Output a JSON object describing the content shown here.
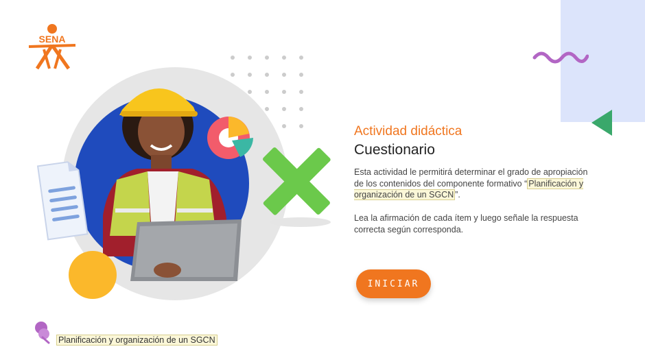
{
  "brand": {
    "logo_text": "SENA",
    "accent_color": "#f0761f"
  },
  "intro": {
    "subtitle": "Actividad didáctica",
    "title": "Cuestionario",
    "paragraph1_prefix": "Esta actividad le permitirá determinar el grado de apropiación de los contenidos del componente formativo “",
    "paragraph1_highlight": "Planificación y organización de un SGCN",
    "paragraph1_suffix": "”.",
    "paragraph2": "Lea la afirmación de cada ítem y luego señale la respuesta correcta según corresponda."
  },
  "actions": {
    "start_label": "INICIAR"
  },
  "footer": {
    "course_name": "Planificación y organización de un SGCN"
  },
  "icons": [
    "sena-logo",
    "document-icon",
    "pie-chart-icon",
    "x-mark-icon",
    "squiggle-decoration",
    "triangle-decoration",
    "pin-icon"
  ],
  "colors": {
    "orange": "#f0761f",
    "panel_blue": "#dce4fb",
    "green": "#3aa86b",
    "purple": "#b266c4",
    "yellow": "#fbb82b",
    "hero_blue": "#1f4bbd"
  }
}
